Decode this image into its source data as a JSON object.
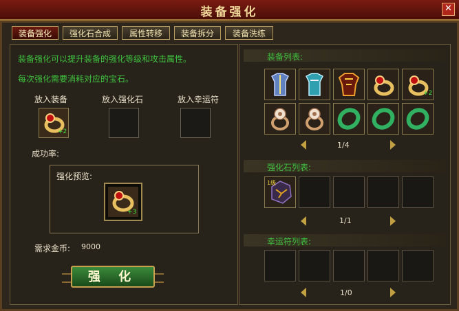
{
  "window": {
    "title": "装备强化",
    "close_icon": "close-icon"
  },
  "tabs": [
    {
      "label": "装备强化",
      "active": true
    },
    {
      "label": "强化石合成",
      "active": false
    },
    {
      "label": "属性转移",
      "active": false
    },
    {
      "label": "装备拆分",
      "active": false
    },
    {
      "label": "装备洗练",
      "active": false
    }
  ],
  "left": {
    "hint1": "装备强化可以提升装备的强化等级和攻击属性。",
    "hint2": "每次强化需要消耗对应的宝石。",
    "slot_equip_label": "放入装备",
    "slot_stone_label": "放入强化石",
    "slot_luck_label": "放入幸运符",
    "equip_plus": "+2",
    "success_label": "成功率:",
    "preview_label": "强化预览:",
    "preview_plus": "+3",
    "gold_label": "需求金币:",
    "gold_value": "9000",
    "enhance_button": "强 化"
  },
  "right": {
    "equip_list_title": "装备列表:",
    "equip_items": [
      "armor-blue-icon",
      "armor-teal-icon",
      "armor-red-icon",
      "ring-gem-icon",
      "ring-gem-icon",
      "ring-flower-icon",
      "ring-flower-icon",
      "bracelet-jade-icon",
      "bracelet-jade-icon",
      "bracelet-jade-icon"
    ],
    "equip_item_plus": "+2",
    "equip_pager": "1/4",
    "stone_list_title": "强化石列表:",
    "stone_item_level": "1级",
    "stone_pager": "1/1",
    "luck_list_title": "幸运符列表:",
    "luck_pager": "1/0"
  },
  "colors": {
    "accent_green": "#3fc23f",
    "title_gold": "#f2d99a",
    "frame_brown": "#5a4020"
  }
}
